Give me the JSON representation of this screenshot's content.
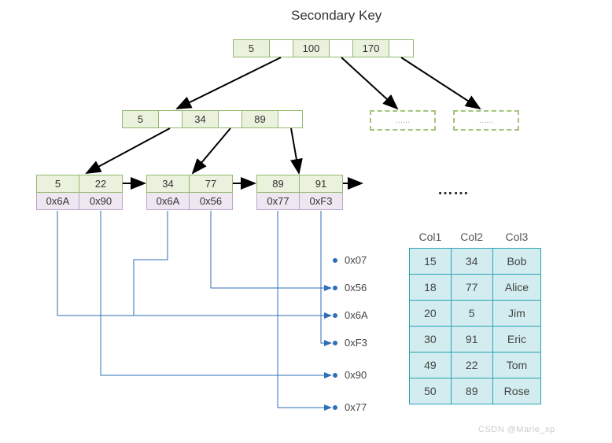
{
  "title": "Secondary Key",
  "root": {
    "keys": [
      "5",
      "100",
      "170"
    ]
  },
  "internal1": {
    "keys": [
      "5",
      "34",
      "89"
    ]
  },
  "placeholders": [
    "......",
    "......"
  ],
  "leaves": [
    {
      "keys": [
        "5",
        "22"
      ],
      "ptrs": [
        "0x6A",
        "0x90"
      ]
    },
    {
      "keys": [
        "34",
        "77"
      ],
      "ptrs": [
        "0x6A",
        "0x56"
      ]
    },
    {
      "keys": [
        "89",
        "91"
      ],
      "ptrs": [
        "0x77",
        "0xF3"
      ]
    }
  ],
  "leaf_ellipsis": "……",
  "addresses": [
    "0x07",
    "0x56",
    "0x6A",
    "0xF3",
    "0x90",
    "0x77"
  ],
  "table": {
    "headers": [
      "Col1",
      "Col2",
      "Col3"
    ],
    "rows": [
      [
        "15",
        "34",
        "Bob"
      ],
      [
        "18",
        "77",
        "Alice"
      ],
      [
        "20",
        "5",
        "Jim"
      ],
      [
        "30",
        "91",
        "Eric"
      ],
      [
        "49",
        "22",
        "Tom"
      ],
      [
        "50",
        "89",
        "Rose"
      ]
    ]
  },
  "watermark": "CSDN @Marie_xp",
  "chart_data": {
    "type": "table",
    "title": "Secondary Key B+Tree index mapping Col2 → row pointer",
    "tree": {
      "root_keys": [
        5,
        100,
        170
      ],
      "internal_keys": [
        5,
        34,
        89
      ],
      "leaf_entries": [
        {
          "key": 5,
          "ptr": "0x6A"
        },
        {
          "key": 22,
          "ptr": "0x90"
        },
        {
          "key": 34,
          "ptr": "0x6A"
        },
        {
          "key": 77,
          "ptr": "0x56"
        },
        {
          "key": 89,
          "ptr": "0x77"
        },
        {
          "key": 91,
          "ptr": "0xF3"
        }
      ]
    },
    "row_addresses": [
      "0x07",
      "0x56",
      "0x6A",
      "0xF3",
      "0x90",
      "0x77"
    ],
    "rows": [
      {
        "Col1": 15,
        "Col2": 34,
        "Col3": "Bob"
      },
      {
        "Col1": 18,
        "Col2": 77,
        "Col3": "Alice"
      },
      {
        "Col1": 20,
        "Col2": 5,
        "Col3": "Jim"
      },
      {
        "Col1": 30,
        "Col2": 91,
        "Col3": "Eric"
      },
      {
        "Col1": 49,
        "Col2": 22,
        "Col3": "Tom"
      },
      {
        "Col1": 50,
        "Col2": 89,
        "Col3": "Rose"
      }
    ]
  }
}
